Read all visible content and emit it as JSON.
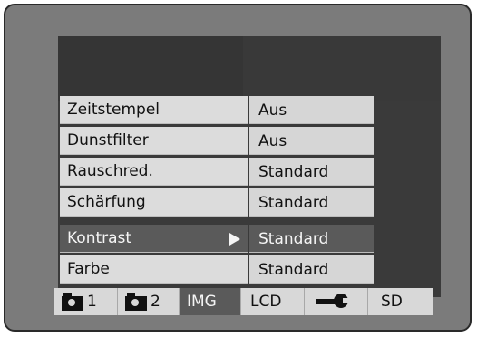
{
  "menu": {
    "rows": [
      {
        "label": "Zeitstempel",
        "value": "Aus",
        "selected": false
      },
      {
        "label": "Dunstfilter",
        "value": "Aus",
        "selected": false
      },
      {
        "label": "Rauschred.",
        "value": "Standard",
        "selected": false
      },
      {
        "label": "Schärfung",
        "value": "Standard",
        "selected": false
      },
      {
        "label": "Kontrast",
        "value": "Standard",
        "selected": true
      },
      {
        "label": "Farbe",
        "value": "Standard",
        "selected": false
      }
    ],
    "selected_arrow_icon": "play-arrow-icon"
  },
  "tabs": {
    "cam1_number": "1",
    "cam1_icon": "camera-icon",
    "cam2_number": "2",
    "cam2_icon": "camera-icon",
    "img": "IMG",
    "lcd": "LCD",
    "setup_icon": "wrench-icon",
    "sd": "SD",
    "active": "IMG"
  },
  "colors": {
    "frame": "#7b7b7b",
    "screen_dark": "#3a3a3a",
    "row_bg": "#dcdcdc",
    "selected_bg": "#5a5a5a"
  }
}
